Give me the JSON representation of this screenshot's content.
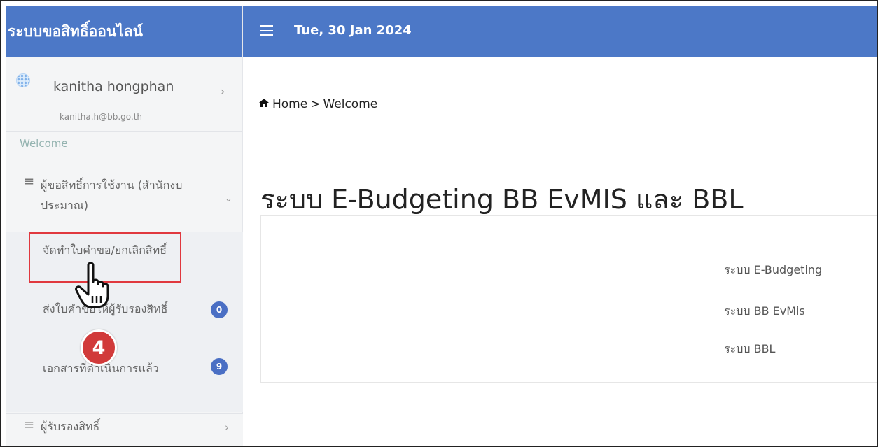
{
  "app": {
    "title": "ระบบขอสิทธิ์ออนไลน์"
  },
  "topbar": {
    "date": "Tue, 30 Jan 2024"
  },
  "user": {
    "name": "kanitha hongphan",
    "email": "kanitha.h@bb.go.th"
  },
  "sidebar": {
    "welcome": "Welcome",
    "group1": {
      "label": "ผู้ขอสิทธิ์การใช้งาน (สำนักงบประมาณ)",
      "items": [
        {
          "label": "จัดทำใบคำขอ/ยกเลิกสิทธิ์",
          "badge": ""
        },
        {
          "label": "ส่งใบคำขอให้ผู้รับรองสิทธิ์",
          "badge": "0"
        },
        {
          "label": "เอกสารที่ดำเนินการแล้ว",
          "badge": "9"
        }
      ]
    },
    "group2": {
      "label": "ผู้รับรองสิทธิ์"
    }
  },
  "breadcrumb": {
    "home": "Home",
    "separator": ">",
    "current": "Welcome"
  },
  "main": {
    "heading": "ระบบ E-Budgeting BB EvMIS และ BBL",
    "systems": [
      {
        "label": "ระบบ E-Budgeting"
      },
      {
        "label": "ระบบ BB EvMis"
      },
      {
        "label": "ระบบ BBL"
      }
    ]
  },
  "annotation": {
    "step_number": "4"
  },
  "colors": {
    "accent": "#4c78c7",
    "badge": "#4a6fc4",
    "highlight": "#e0383e",
    "step": "#d13a3a"
  },
  "icons": {
    "menu": "hamburger-icon",
    "home": "home-icon",
    "list": "list-icon",
    "chevron": "chevron-icon",
    "pointer": "hand-pointer-icon"
  }
}
